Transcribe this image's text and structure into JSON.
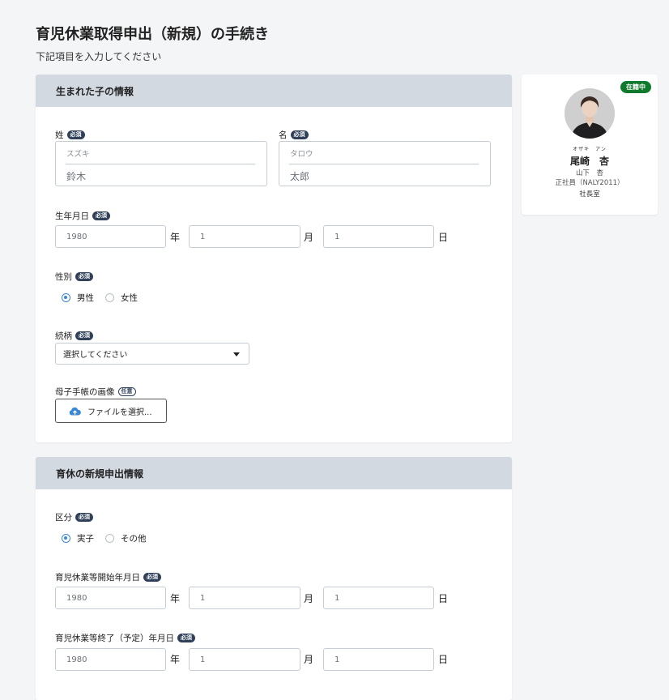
{
  "page": {
    "title": "育児休業取得申出（新規）の手続き",
    "subtitle": "下記項目を入力してください"
  },
  "tags": {
    "required": "必須",
    "optional": "任意"
  },
  "section1": {
    "title": "生まれた子の情報",
    "last_name": {
      "label": "姓",
      "kana_placeholder": "スズキ",
      "kanji_placeholder": "鈴木"
    },
    "first_name": {
      "label": "名",
      "kana_placeholder": "タロウ",
      "kanji_placeholder": "太郎"
    },
    "birthdate": {
      "label": "生年月日",
      "year": "1980",
      "month": "1",
      "day": "1"
    },
    "gender": {
      "label": "性別",
      "options": [
        "男性",
        "女性"
      ],
      "selected": "男性"
    },
    "relation": {
      "label": "続柄",
      "value": "選択してください"
    },
    "handbook": {
      "label": "母子手帳の画像",
      "button": "ファイルを選択..."
    }
  },
  "section2": {
    "title": "育休の新規申出情報",
    "category": {
      "label": "区分",
      "options": [
        "実子",
        "その他"
      ],
      "selected": "実子"
    },
    "start_date": {
      "label": "育児休業等開始年月日",
      "year": "1980",
      "month": "1",
      "day": "1"
    },
    "end_date": {
      "label": "育児休業等終了（予定）年月日",
      "year": "1980",
      "month": "1",
      "day": "1"
    }
  },
  "units": {
    "year": "年",
    "month": "月",
    "day": "日"
  },
  "profile": {
    "status": "在籍中",
    "kana": "オザキ　アン",
    "name": "尾崎　杏",
    "sub_name": "山下　杏",
    "employment": "正社員（NALY2011）",
    "department": "社長室",
    "status_color": "#0f7a2c"
  },
  "colors": {
    "accent": "#3b87d6",
    "header_bg": "#d3d9e0",
    "tag_bg": "#2f4058"
  },
  "icons": {
    "upload": "cloud-upload-icon",
    "dropdown": "chevron-down-icon"
  }
}
